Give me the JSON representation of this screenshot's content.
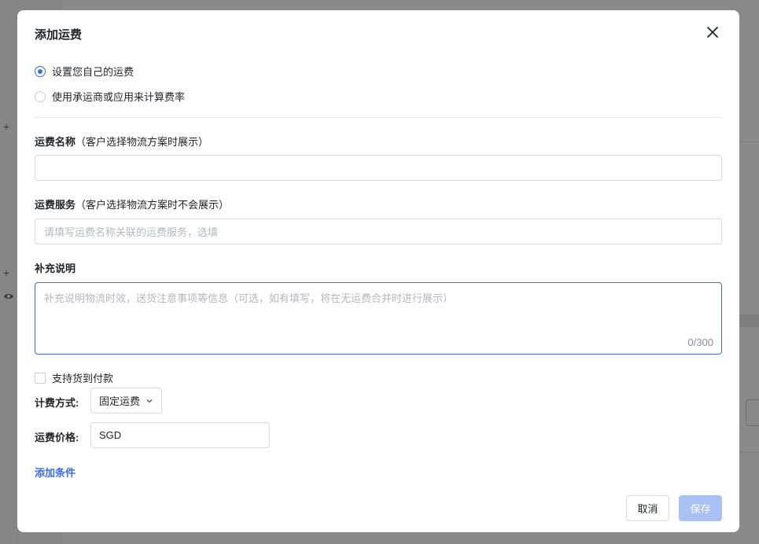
{
  "modal": {
    "title": "添加运费",
    "close_icon": "close-icon"
  },
  "rate_options": [
    {
      "label": "设置您自己的运费",
      "checked": true
    },
    {
      "label": "使用承运商或应用来计算费率",
      "checked": false
    }
  ],
  "shipping_name": {
    "label": "运费名称",
    "sub": "（客户选择物流方案时展示）",
    "value": ""
  },
  "shipping_service": {
    "label": "运费服务",
    "sub": "（客户选择物流方案时不会展示）",
    "placeholder": "请填写运费名称关联的运费服务，选填"
  },
  "notes": {
    "label": "补充说明",
    "placeholder": "补充说明物流时效，送货注意事项等信息（可选，如有填写，将在无运费合并时进行展示）",
    "counter": "0/300"
  },
  "cod": {
    "label": "支持货到付款",
    "checked": false
  },
  "billing": {
    "label": "计费方式:",
    "selected": "固定运费",
    "chevron_icon": "chevron-down-icon"
  },
  "price": {
    "label": "运费价格:",
    "currency": "SGD"
  },
  "add_condition": "添加条件",
  "footer": {
    "cancel": "取消",
    "save": "保存"
  },
  "background_icons": [
    "plus-icon",
    "plus-icon",
    "eye-icon"
  ],
  "colors": {
    "accent": "#3b6fe0",
    "save_disabled": "#a9c0f5",
    "overlay": "#8a8a8a"
  }
}
